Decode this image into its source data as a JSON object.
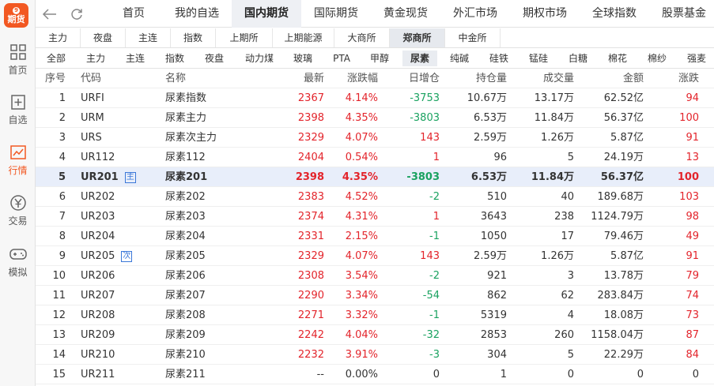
{
  "app": {
    "logo_text": "期货",
    "logo_mark": "9"
  },
  "sidebar": {
    "items": [
      {
        "label": "首页",
        "icon": "grid-icon"
      },
      {
        "label": "自选",
        "icon": "star-list-icon"
      },
      {
        "label": "行情",
        "icon": "chart-icon",
        "active": true
      },
      {
        "label": "交易",
        "icon": "yen-icon"
      },
      {
        "label": "模拟",
        "icon": "gamepad-icon"
      }
    ]
  },
  "topnav": {
    "tabs": [
      "首页",
      "我的自选",
      "国内期货",
      "国际期货",
      "黄金现货",
      "外汇市场",
      "期权市场",
      "全球指数",
      "股票基金"
    ],
    "active": "国内期货"
  },
  "exchange_tabs": {
    "items": [
      "主力",
      "夜盘",
      "主连",
      "指数",
      "上期所",
      "上期能源",
      "大商所",
      "郑商所",
      "中金所"
    ],
    "active": "郑商所"
  },
  "product_tabs": {
    "items": [
      "全部",
      "主力",
      "主连",
      "指数",
      "夜盘",
      "动力煤",
      "玻璃",
      "PTA",
      "甲醇",
      "尿素",
      "纯碱",
      "硅铁",
      "锰硅",
      "白糖",
      "棉花",
      "棉纱",
      "强麦"
    ],
    "active": "尿素"
  },
  "table": {
    "headers": [
      "序号",
      "代码",
      "名称",
      "最新",
      "涨跌幅",
      "日增仓",
      "持仓量",
      "成交量",
      "金额",
      "涨跌"
    ],
    "rows": [
      {
        "idx": "1",
        "code": "URFI",
        "tag": "",
        "name": "尿素指数",
        "last": "2367",
        "chg": "4.14%",
        "doi": "-3753",
        "oi": "10.67万",
        "vol": "13.17万",
        "amt": "62.52亿",
        "up": "94"
      },
      {
        "idx": "2",
        "code": "URM",
        "tag": "",
        "name": "尿素主力",
        "last": "2398",
        "chg": "4.35%",
        "doi": "-3803",
        "oi": "6.53万",
        "vol": "11.84万",
        "amt": "56.37亿",
        "up": "100"
      },
      {
        "idx": "3",
        "code": "URS",
        "tag": "",
        "name": "尿素次主力",
        "last": "2329",
        "chg": "4.07%",
        "doi": "143",
        "oi": "2.59万",
        "vol": "1.26万",
        "amt": "5.87亿",
        "up": "91"
      },
      {
        "idx": "4",
        "code": "UR112",
        "tag": "",
        "name": "尿素112",
        "last": "2404",
        "chg": "0.54%",
        "doi": "1",
        "oi": "96",
        "vol": "5",
        "amt": "24.19万",
        "up": "13"
      },
      {
        "idx": "5",
        "code": "UR201",
        "tag": "主",
        "name": "尿素201",
        "last": "2398",
        "chg": "4.35%",
        "doi": "-3803",
        "oi": "6.53万",
        "vol": "11.84万",
        "amt": "56.37亿",
        "up": "100",
        "selected": true
      },
      {
        "idx": "6",
        "code": "UR202",
        "tag": "",
        "name": "尿素202",
        "last": "2383",
        "chg": "4.52%",
        "doi": "-2",
        "oi": "510",
        "vol": "40",
        "amt": "189.68万",
        "up": "103"
      },
      {
        "idx": "7",
        "code": "UR203",
        "tag": "",
        "name": "尿素203",
        "last": "2374",
        "chg": "4.31%",
        "doi": "1",
        "oi": "3643",
        "vol": "238",
        "amt": "1124.79万",
        "up": "98"
      },
      {
        "idx": "8",
        "code": "UR204",
        "tag": "",
        "name": "尿素204",
        "last": "2331",
        "chg": "2.15%",
        "doi": "-1",
        "oi": "1050",
        "vol": "17",
        "amt": "79.46万",
        "up": "49"
      },
      {
        "idx": "9",
        "code": "UR205",
        "tag": "次",
        "name": "尿素205",
        "last": "2329",
        "chg": "4.07%",
        "doi": "143",
        "oi": "2.59万",
        "vol": "1.26万",
        "amt": "5.87亿",
        "up": "91"
      },
      {
        "idx": "10",
        "code": "UR206",
        "tag": "",
        "name": "尿素206",
        "last": "2308",
        "chg": "3.54%",
        "doi": "-2",
        "oi": "921",
        "vol": "3",
        "amt": "13.78万",
        "up": "79"
      },
      {
        "idx": "11",
        "code": "UR207",
        "tag": "",
        "name": "尿素207",
        "last": "2290",
        "chg": "3.34%",
        "doi": "-54",
        "oi": "862",
        "vol": "62",
        "amt": "283.84万",
        "up": "74"
      },
      {
        "idx": "12",
        "code": "UR208",
        "tag": "",
        "name": "尿素208",
        "last": "2271",
        "chg": "3.32%",
        "doi": "-1",
        "oi": "5319",
        "vol": "4",
        "amt": "18.08万",
        "up": "73"
      },
      {
        "idx": "13",
        "code": "UR209",
        "tag": "",
        "name": "尿素209",
        "last": "2242",
        "chg": "4.04%",
        "doi": "-32",
        "oi": "2853",
        "vol": "260",
        "amt": "1158.04万",
        "up": "87"
      },
      {
        "idx": "14",
        "code": "UR210",
        "tag": "",
        "name": "尿素210",
        "last": "2232",
        "chg": "3.91%",
        "doi": "-3",
        "oi": "304",
        "vol": "5",
        "amt": "22.29万",
        "up": "84"
      },
      {
        "idx": "15",
        "code": "UR211",
        "tag": "",
        "name": "尿素211",
        "last": "--",
        "chg": "0.00%",
        "doi": "0",
        "oi": "1",
        "vol": "0",
        "amt": "0",
        "up": "0"
      }
    ]
  },
  "colors": {
    "accent": "#f25822",
    "up": "#e3242b",
    "down": "#1aa260",
    "tag": "#3a77d8"
  }
}
